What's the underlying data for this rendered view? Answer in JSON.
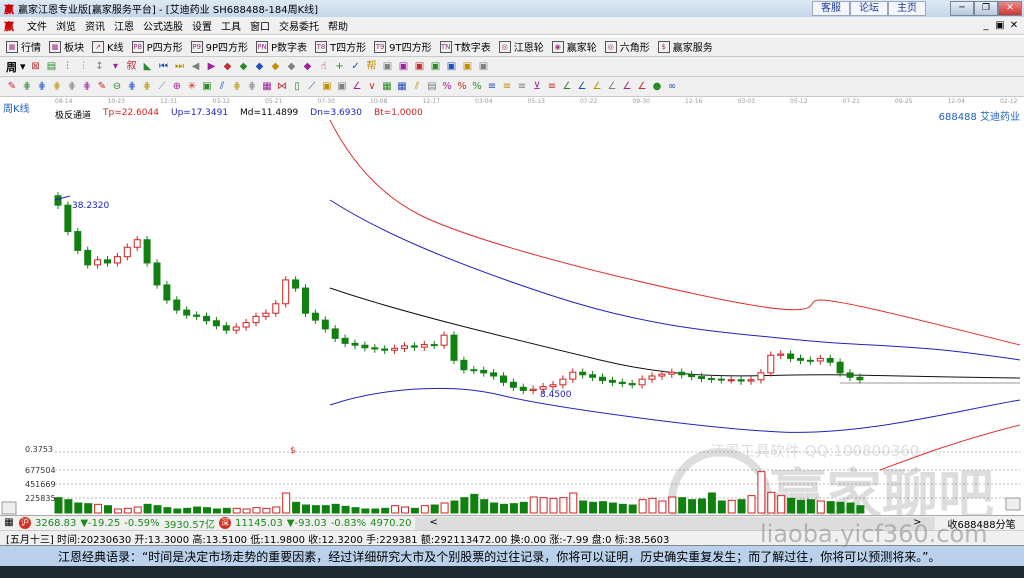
{
  "window": {
    "title": "赢家江恩专业版[赢家服务平台] - [艾迪药业  SH688488-184周K线]",
    "web_buttons": [
      "客服",
      "论坛",
      "主页"
    ],
    "min": "─",
    "restore": "❐",
    "close": "✕",
    "logo": "赢"
  },
  "menu": [
    "文件",
    "浏览",
    "资讯",
    "江恩",
    "公式选股",
    "设置",
    "工具",
    "窗口",
    "交易委托",
    "帮助"
  ],
  "mdi_buttons": [
    "_",
    "▣",
    "✕"
  ],
  "toolbar1": [
    {
      "icon": "grid-icon",
      "glyph": "▦",
      "label": "行情"
    },
    {
      "icon": "blocks-icon",
      "glyph": "▩",
      "label": "板块"
    },
    {
      "icon": "kline-icon",
      "glyph": "↗",
      "label": "K线"
    },
    {
      "icon": "p4-icon",
      "glyph": "P8",
      "label": "P四方形"
    },
    {
      "icon": "9p4-icon",
      "glyph": "P9",
      "label": "9P四方形"
    },
    {
      "icon": "pn-icon",
      "glyph": "PN",
      "label": "P数字表"
    },
    {
      "icon": "t8-icon",
      "glyph": "T8",
      "label": "T四方形"
    },
    {
      "icon": "t9-icon",
      "glyph": "T9",
      "label": "9T四方形"
    },
    {
      "icon": "tn-icon",
      "glyph": "TN",
      "label": "T数字表"
    },
    {
      "icon": "wheel-icon",
      "glyph": "◎",
      "label": "江恩轮"
    },
    {
      "icon": "winner-wheel-icon",
      "glyph": "◉",
      "label": "赢家轮"
    },
    {
      "icon": "hexagon-icon",
      "glyph": "◎",
      "label": "六角形"
    },
    {
      "icon": "dollar-icon",
      "glyph": "$",
      "label": "赢家服务"
    }
  ],
  "toolbar2": {
    "period": "周",
    "glyphs": [
      "⊠",
      "▤",
      "⫶",
      "⫶",
      "↕",
      "▾",
      "叙",
      "◣",
      "⏮",
      "⏭",
      "◀",
      "▶",
      "◆",
      "◆",
      "◆",
      "◆",
      "◆",
      "◆",
      "☝",
      "+",
      "✓",
      "帮",
      "▣",
      "▣",
      "▣",
      "▣",
      "▣",
      "▣",
      "▣"
    ]
  },
  "toolbar3": {
    "glyphs": [
      "✎",
      "⋕",
      "⋕",
      "⋕",
      "⋕",
      "⋕",
      "✎",
      "⊖",
      "⋕",
      "⋕",
      "⟋",
      "⊕",
      "✳",
      "▣",
      "⫽",
      "⋕",
      "⋕",
      "▦",
      "⋈",
      "▯",
      "⟋",
      "▣",
      "▣",
      "∠",
      "∨",
      "▦",
      "▦",
      "⫽",
      "▤",
      "%",
      "%",
      "%",
      "≡",
      "≡",
      "≡",
      "⊻",
      "≡",
      "∠",
      "∠",
      "∠",
      "∠",
      "∠",
      "∠",
      "●",
      "∞"
    ]
  },
  "date_axis": [
    "08-14",
    "10-23",
    "12-31",
    "03-12",
    "05-21",
    "07-30",
    "10-08",
    "12-17",
    "03-04",
    "05-13",
    "07-22",
    "09-30",
    "12-16",
    "03-03",
    "05-12",
    "07-21",
    "09-25",
    "12-04",
    "02-12"
  ],
  "indicator": {
    "period_label": "周K线",
    "name": "极反通道",
    "tp": "Tp=22.6044",
    "up": "Up=17.3491",
    "md": "Md=11.4899",
    "dn": "Dn=3.6930",
    "bt": "Bt=1.0000",
    "stock": "688488  艾迪药业"
  },
  "chart_data": {
    "type": "candlestick",
    "high_label": "38.2320",
    "low_label": "8.4500",
    "price_range": [
      5,
      43
    ],
    "close": [
      38.2,
      34,
      31,
      28.7,
      29.5,
      29,
      30,
      31.5,
      32.7,
      29,
      25.5,
      23.1,
      21.5,
      20.7,
      20.5,
      19.8,
      19,
      18.3,
      18.8,
      19.5,
      20.5,
      21,
      22.5,
      26.3,
      25,
      21,
      19.9,
      18.5,
      17,
      16.2,
      15.9,
      15.5,
      15.3,
      15.1,
      15.4,
      15.8,
      15.6,
      16,
      15.9,
      17.5,
      13.5,
      12,
      11.9,
      11.5,
      11,
      10,
      9.2,
      8.7,
      8.9,
      9.3,
      9.6,
      10.5,
      11.6,
      11.2,
      10.8,
      10.3,
      10,
      9.8,
      9.6,
      10.5,
      11,
      11.3,
      11.6,
      11.2,
      10.9,
      10.6,
      10.5,
      10.4,
      10.4,
      10.2,
      10.4,
      11.5,
      14.3,
      14.5,
      13.8,
      13.5,
      13.4,
      13.8,
      13.2,
      11.5,
      10.8,
      10.4
    ],
    "volume_axis": [
      "0.3753",
      "677504",
      "451669",
      "225835"
    ],
    "volume": [
      230000,
      200000,
      150000,
      140000,
      130000,
      110000,
      60000,
      70000,
      90000,
      130000,
      110000,
      80000,
      60000,
      70000,
      90000,
      80000,
      60000,
      70000,
      70000,
      60000,
      80000,
      70000,
      90000,
      300000,
      160000,
      120000,
      110000,
      110000,
      130000,
      100000,
      80000,
      60000,
      60000,
      70000,
      110000,
      90000,
      70000,
      110000,
      120000,
      150000,
      180000,
      230000,
      280000,
      200000,
      150000,
      130000,
      140000,
      160000,
      240000,
      230000,
      220000,
      230000,
      300000,
      180000,
      160000,
      170000,
      150000,
      130000,
      120000,
      200000,
      220000,
      180000,
      240000,
      230000,
      200000,
      210000,
      300000,
      180000,
      190000,
      200000,
      260000,
      620000,
      310000,
      260000,
      220000,
      190000,
      200000,
      180000,
      170000,
      160000,
      150000,
      110000
    ]
  },
  "watermark": {
    "line1": "江恩工具软件  QQ:100800360",
    "line2": "赢家聊吧",
    "line3": "liaoba.yicf360.com"
  },
  "status1": {
    "sh_index": "3268.83",
    "sh_change": "▼-19.25",
    "sh_pct": "-0.59%",
    "sh_amount": "3930.57亿",
    "sz_index": "11145.03",
    "sz_change": "▼-93.03",
    "sz_pct": "-0.83%",
    "sz_amount": "4970.20",
    "scroll_left": "<",
    "scroll_right": ">",
    "feed": "收688488分笔",
    "sh_icon": "沪",
    "sz_icon": "深"
  },
  "status2": "[五月十三] 时间:20230630 开:13.3000 高:13.5100 低:11.9800 收:12.3200 手:229381 额:292113472.00 换:0.00 涨:-7.99 盘:0 标:38.5603",
  "quote": "江恩经典语录：“时间是决定市场走势的重要因素，经过详细研究大市及个别股票的过往记录，你将可以证明，历史确实重复发生；而了解过往，你将可以预测将来。”。",
  "colors": {
    "up": "#d02020",
    "down": "#108010",
    "blue": "#2020c0",
    "red": "#e03030"
  }
}
